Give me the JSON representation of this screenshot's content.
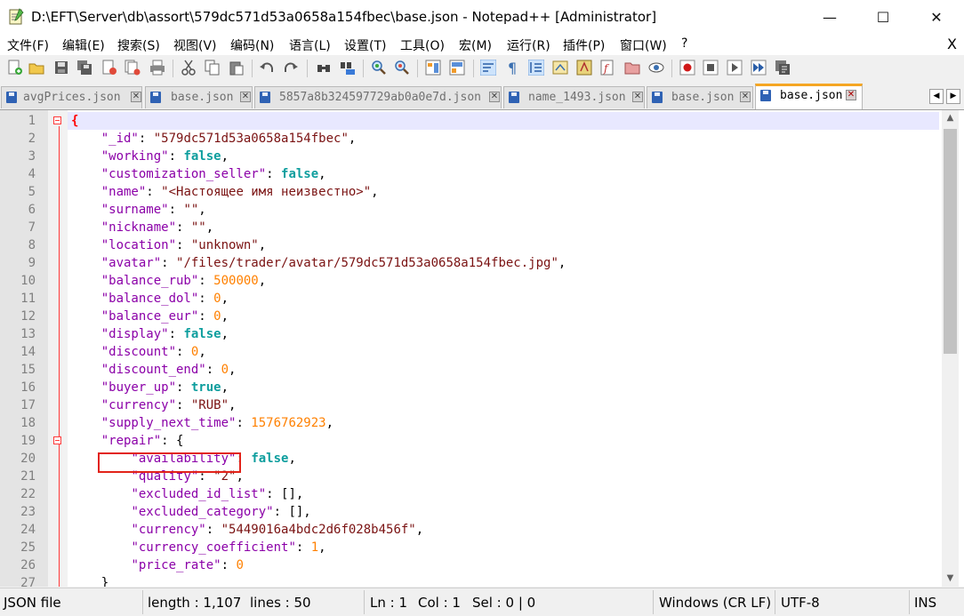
{
  "window": {
    "title": "D:\\EFT\\Server\\db\\assort\\579dc571d53a0658a154fbec\\base.json - Notepad++ [Administrator]",
    "minimize": "—",
    "maximize": "☐",
    "close": "✕"
  },
  "menu": {
    "items": [
      "文件(F)",
      "编辑(E)",
      "搜索(S)",
      "视图(V)",
      "编码(N)",
      "语言(L)",
      "设置(T)",
      "工具(O)",
      "宏(M)",
      "运行(R)",
      "插件(P)",
      "窗口(W)",
      "?"
    ],
    "close_doc": "X"
  },
  "toolbar": {
    "icons": [
      "new-file",
      "open-file",
      "save",
      "save-all",
      "close",
      "close-all",
      "print",
      "cut",
      "copy",
      "paste",
      "undo",
      "redo",
      "find",
      "replace",
      "zoom-in",
      "zoom-out",
      "sync-vertical",
      "sync-horizontal",
      "word-wrap",
      "show-all-chars",
      "indent-guide",
      "user-defined-language",
      "document-map",
      "function-list",
      "folder-as-workspace",
      "monitoring",
      "record-macro",
      "stop-recording",
      "playback-macro",
      "run-macro-multiple",
      "save-macro"
    ]
  },
  "tabs": [
    {
      "label": "avgPrices.json",
      "active": false
    },
    {
      "label": "base.json",
      "active": false
    },
    {
      "label": "5857a8b324597729ab0a0e7d.json",
      "active": false
    },
    {
      "label": "name_1493.json",
      "active": false
    },
    {
      "label": "base.json",
      "active": false
    },
    {
      "label": "base.json",
      "active": true
    }
  ],
  "tab_scroll": {
    "left": "◀",
    "right": "▶"
  },
  "editor": {
    "lines": [
      {
        "n": "1",
        "indent": "",
        "tokens": [
          {
            "t": "{",
            "c": "brace-red"
          }
        ]
      },
      {
        "n": "2",
        "indent": "    ",
        "tokens": [
          {
            "t": "\"_id\"",
            "c": "k"
          },
          {
            "t": ": ",
            "c": "p"
          },
          {
            "t": "\"579dc571d53a0658a154fbec\"",
            "c": "s"
          },
          {
            "t": ",",
            "c": "p"
          }
        ]
      },
      {
        "n": "3",
        "indent": "    ",
        "tokens": [
          {
            "t": "\"working\"",
            "c": "k"
          },
          {
            "t": ": ",
            "c": "p"
          },
          {
            "t": "false",
            "c": "b"
          },
          {
            "t": ",",
            "c": "p"
          }
        ]
      },
      {
        "n": "4",
        "indent": "    ",
        "tokens": [
          {
            "t": "\"customization_seller\"",
            "c": "k"
          },
          {
            "t": ": ",
            "c": "p"
          },
          {
            "t": "false",
            "c": "b"
          },
          {
            "t": ",",
            "c": "p"
          }
        ]
      },
      {
        "n": "5",
        "indent": "    ",
        "tokens": [
          {
            "t": "\"name\"",
            "c": "k"
          },
          {
            "t": ": ",
            "c": "p"
          },
          {
            "t": "\"<Настоящее имя неизвестно>\"",
            "c": "s"
          },
          {
            "t": ",",
            "c": "p"
          }
        ]
      },
      {
        "n": "6",
        "indent": "    ",
        "tokens": [
          {
            "t": "\"surname\"",
            "c": "k"
          },
          {
            "t": ": ",
            "c": "p"
          },
          {
            "t": "\"\"",
            "c": "s"
          },
          {
            "t": ",",
            "c": "p"
          }
        ]
      },
      {
        "n": "7",
        "indent": "    ",
        "tokens": [
          {
            "t": "\"nickname\"",
            "c": "k"
          },
          {
            "t": ": ",
            "c": "p"
          },
          {
            "t": "\"\"",
            "c": "s"
          },
          {
            "t": ",",
            "c": "p"
          }
        ]
      },
      {
        "n": "8",
        "indent": "    ",
        "tokens": [
          {
            "t": "\"location\"",
            "c": "k"
          },
          {
            "t": ": ",
            "c": "p"
          },
          {
            "t": "\"unknown\"",
            "c": "s"
          },
          {
            "t": ",",
            "c": "p"
          }
        ]
      },
      {
        "n": "9",
        "indent": "    ",
        "tokens": [
          {
            "t": "\"avatar\"",
            "c": "k"
          },
          {
            "t": ": ",
            "c": "p"
          },
          {
            "t": "\"/files/trader/avatar/579dc571d53a0658a154fbec.jpg\"",
            "c": "s"
          },
          {
            "t": ",",
            "c": "p"
          }
        ]
      },
      {
        "n": "10",
        "indent": "    ",
        "tokens": [
          {
            "t": "\"balance_rub\"",
            "c": "k"
          },
          {
            "t": ": ",
            "c": "p"
          },
          {
            "t": "500000",
            "c": "n"
          },
          {
            "t": ",",
            "c": "p"
          }
        ]
      },
      {
        "n": "11",
        "indent": "    ",
        "tokens": [
          {
            "t": "\"balance_dol\"",
            "c": "k"
          },
          {
            "t": ": ",
            "c": "p"
          },
          {
            "t": "0",
            "c": "n"
          },
          {
            "t": ",",
            "c": "p"
          }
        ]
      },
      {
        "n": "12",
        "indent": "    ",
        "tokens": [
          {
            "t": "\"balance_eur\"",
            "c": "k"
          },
          {
            "t": ": ",
            "c": "p"
          },
          {
            "t": "0",
            "c": "n"
          },
          {
            "t": ",",
            "c": "p"
          }
        ]
      },
      {
        "n": "13",
        "indent": "    ",
        "tokens": [
          {
            "t": "\"display\"",
            "c": "k"
          },
          {
            "t": ": ",
            "c": "p"
          },
          {
            "t": "false",
            "c": "b"
          },
          {
            "t": ",",
            "c": "p"
          }
        ]
      },
      {
        "n": "14",
        "indent": "    ",
        "tokens": [
          {
            "t": "\"discount\"",
            "c": "k"
          },
          {
            "t": ": ",
            "c": "p"
          },
          {
            "t": "0",
            "c": "n"
          },
          {
            "t": ",",
            "c": "p"
          }
        ]
      },
      {
        "n": "15",
        "indent": "    ",
        "tokens": [
          {
            "t": "\"discount_end\"",
            "c": "k"
          },
          {
            "t": ": ",
            "c": "p"
          },
          {
            "t": "0",
            "c": "n"
          },
          {
            "t": ",",
            "c": "p"
          }
        ]
      },
      {
        "n": "16",
        "indent": "    ",
        "tokens": [
          {
            "t": "\"buyer_up\"",
            "c": "k"
          },
          {
            "t": ": ",
            "c": "p"
          },
          {
            "t": "true",
            "c": "b"
          },
          {
            "t": ",",
            "c": "p"
          }
        ]
      },
      {
        "n": "17",
        "indent": "    ",
        "tokens": [
          {
            "t": "\"currency\"",
            "c": "k"
          },
          {
            "t": ": ",
            "c": "p"
          },
          {
            "t": "\"RUB\"",
            "c": "s"
          },
          {
            "t": ",",
            "c": "p"
          }
        ]
      },
      {
        "n": "18",
        "indent": "    ",
        "tokens": [
          {
            "t": "\"supply_next_time\"",
            "c": "k"
          },
          {
            "t": ": ",
            "c": "p"
          },
          {
            "t": "1576762923",
            "c": "n"
          },
          {
            "t": ",",
            "c": "p"
          }
        ]
      },
      {
        "n": "19",
        "indent": "    ",
        "tokens": [
          {
            "t": "\"repair\"",
            "c": "k"
          },
          {
            "t": ": {",
            "c": "p"
          }
        ]
      },
      {
        "n": "20",
        "indent": "        ",
        "tokens": [
          {
            "t": "\"availability\"",
            "c": "k"
          },
          {
            "t": ": ",
            "c": "p"
          },
          {
            "t": "false",
            "c": "b"
          },
          {
            "t": ",",
            "c": "p"
          }
        ]
      },
      {
        "n": "21",
        "indent": "        ",
        "tokens": [
          {
            "t": "\"quality\"",
            "c": "k"
          },
          {
            "t": ": ",
            "c": "p"
          },
          {
            "t": "\"2\"",
            "c": "s"
          },
          {
            "t": ",",
            "c": "p"
          }
        ]
      },
      {
        "n": "22",
        "indent": "        ",
        "tokens": [
          {
            "t": "\"excluded_id_list\"",
            "c": "k"
          },
          {
            "t": ": [],",
            "c": "p"
          }
        ]
      },
      {
        "n": "23",
        "indent": "        ",
        "tokens": [
          {
            "t": "\"excluded_category\"",
            "c": "k"
          },
          {
            "t": ": [],",
            "c": "p"
          }
        ]
      },
      {
        "n": "24",
        "indent": "        ",
        "tokens": [
          {
            "t": "\"currency\"",
            "c": "k"
          },
          {
            "t": ": ",
            "c": "p"
          },
          {
            "t": "\"5449016a4bdc2d6f028b456f\"",
            "c": "s"
          },
          {
            "t": ",",
            "c": "p"
          }
        ]
      },
      {
        "n": "25",
        "indent": "        ",
        "tokens": [
          {
            "t": "\"currency_coefficient\"",
            "c": "k"
          },
          {
            "t": ": ",
            "c": "p"
          },
          {
            "t": "1",
            "c": "n"
          },
          {
            "t": ",",
            "c": "p"
          }
        ]
      },
      {
        "n": "26",
        "indent": "        ",
        "tokens": [
          {
            "t": "\"price_rate\"",
            "c": "k"
          },
          {
            "t": ": ",
            "c": "p"
          },
          {
            "t": "0",
            "c": "n"
          }
        ]
      },
      {
        "n": "27",
        "indent": "    ",
        "tokens": [
          {
            "t": "}",
            "c": "p"
          }
        ]
      }
    ],
    "fold_lines": [
      1,
      19
    ],
    "highlighted_line": 14,
    "colors": {
      "key": "#8b00a8",
      "string": "#7a1212",
      "bool": "#0e9e9e",
      "number": "#ff8000",
      "highlight_box": "#e2231a"
    }
  },
  "status": {
    "type": "JSON file",
    "length": "length : 1,107",
    "lines": "lines : 50",
    "ln": "Ln : 1",
    "col": "Col : 1",
    "sel": "Sel : 0 | 0",
    "eol": "Windows (CR LF)",
    "encoding": "UTF-8",
    "mode": "INS"
  }
}
